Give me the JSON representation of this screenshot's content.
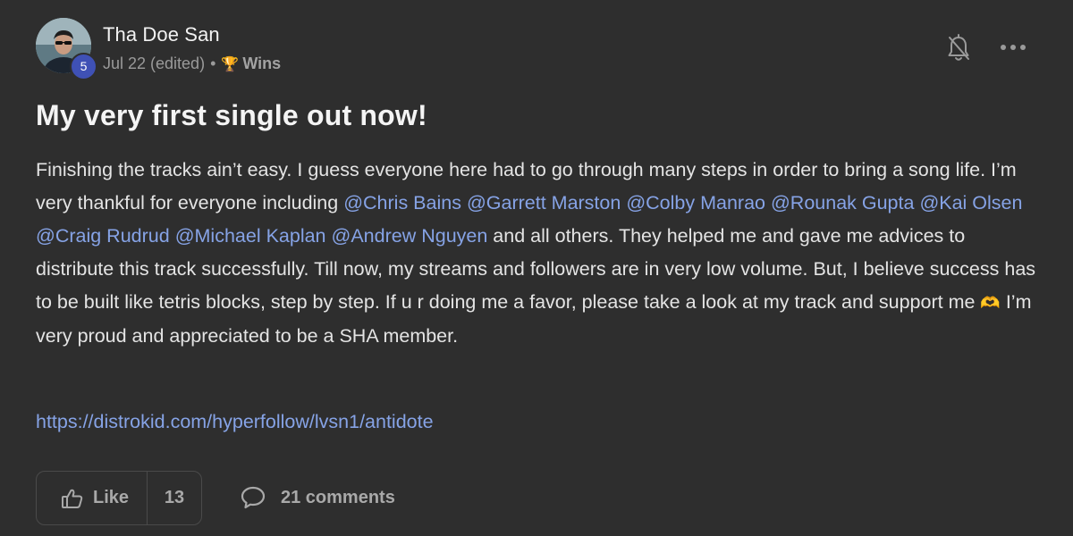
{
  "author": {
    "name": "Tha Doe San",
    "level": "5"
  },
  "meta": {
    "date": "Jul 22 (edited)",
    "separator": "•",
    "category_icon": "trophy-icon",
    "category": "Wins"
  },
  "header_actions": {
    "bell_icon": "bell-off-icon",
    "more_icon": "more-horizontal-icon"
  },
  "post": {
    "title": "My very first single out now!",
    "body_parts": {
      "p1": "Finishing the tracks ain’t easy. I guess everyone here had to go through many steps in order to bring a song life. I’m very thankful for everyone including ",
      "mentions": [
        "@Chris Bains",
        "@Garrett Marston",
        "@Colby Manrao",
        "@Rounak Gupta",
        "@Kai Olsen",
        "@Craig Rudrud",
        "@Michael Kaplan",
        "@Andrew Nguyen"
      ],
      "p2": " and all others. They helped me and gave me advices to distribute this track successfully. Till now, my streams and followers are in very low volume. But, I believe success has to be built like tetris blocks, step by step. If u r doing me a favor, please take a look at my track and support me ",
      "emoji": "🫶",
      "p3": " I’m very proud and appreciated to be a SHA member."
    },
    "link": "https://distrokid.com/hyperfollow/lvsn1/antidote"
  },
  "actions": {
    "like_label": "Like",
    "like_count": "13",
    "comments_label": "21 comments"
  },
  "colors": {
    "background": "#2e2e2e",
    "link": "#86a3e6",
    "level_badge": "#3f51b5"
  }
}
